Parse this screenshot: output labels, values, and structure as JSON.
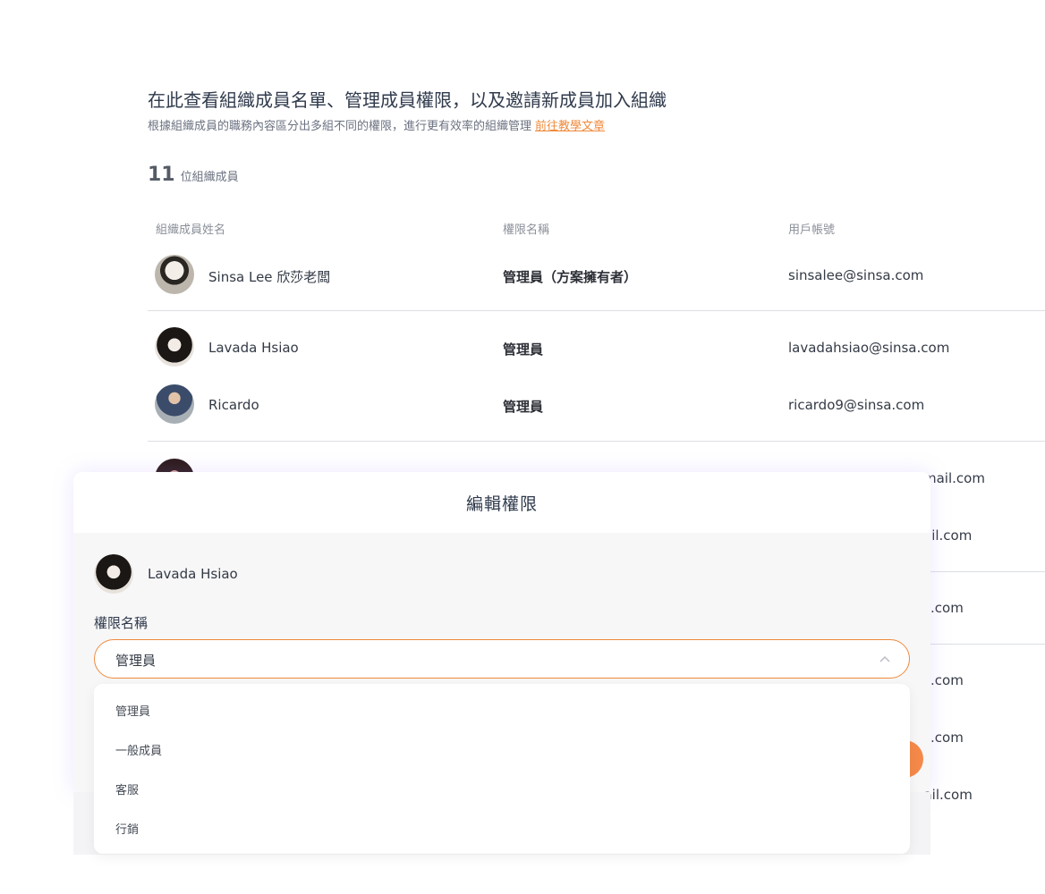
{
  "header": {
    "title": "在此查看組織成員名單、管理成員權限，以及邀請新成員加入組織",
    "subtitle": "根據組織成員的職務內容區分出多組不同的權限，進行更有效率的組織管理",
    "link_label": "前往教學文章"
  },
  "summary": {
    "count": "11",
    "unit": "位組織成員"
  },
  "table": {
    "columns": {
      "name": "組織成員姓名",
      "role": "權限名稱",
      "account": "用戶帳號"
    },
    "rows": [
      {
        "name": "Sinsa Lee 欣莎老闆",
        "role": "管理員（方案擁有者）",
        "account": "sinsalee@sinsa.com"
      },
      {
        "name": "Lavada Hsiao",
        "role": "管理員",
        "account": "lavadahsiao@sinsa.com"
      },
      {
        "name": "Ricardo",
        "role": "管理員",
        "account": "ricardo9@sinsa.com"
      }
    ],
    "partial_accounts": [
      "mail.com",
      "ail.com",
      ".com",
      ".com",
      ".com",
      "tmail.com"
    ]
  },
  "modal": {
    "title": "編輯權限",
    "user_name": "Lavada Hsiao",
    "field_label": "權限名稱",
    "selected": "管理員",
    "options": [
      "管理員",
      "一般成員",
      "客服",
      "行銷"
    ]
  },
  "colors": {
    "accent": "#f08a3c",
    "button": "#f5894a",
    "text": "#2f3a4c",
    "divider": "#dcdfe4"
  }
}
